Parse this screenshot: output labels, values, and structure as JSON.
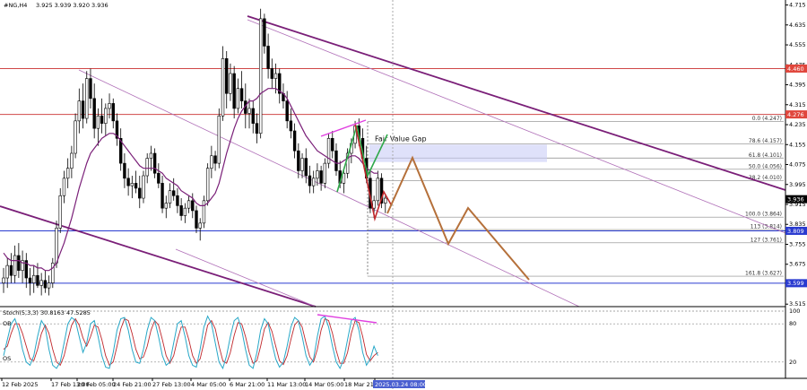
{
  "header": {
    "symbol": "#NG,H4",
    "ohlc": "3.925 3.939 3.920 3.936"
  },
  "chart_data": {
    "type": "candlestick",
    "y_ticks": [
      4.715,
      4.635,
      4.555,
      4.475,
      4.395,
      4.315,
      4.235,
      4.155,
      4.075,
      3.995,
      3.915,
      3.835,
      3.755,
      3.675,
      3.595,
      3.515
    ],
    "price_tags": [
      {
        "value": 4.46,
        "label": "4.460",
        "color": "#e0463c"
      },
      {
        "value": 4.276,
        "label": "4.276",
        "color": "#e0463c"
      },
      {
        "value": 3.936,
        "label": "3.936",
        "color": "#000000"
      },
      {
        "value": 3.809,
        "label": "3.809",
        "color": "#2a3bd0"
      },
      {
        "value": 3.599,
        "label": "3.599",
        "color": "#2a3bd0"
      }
    ],
    "horizontal_levels": [
      {
        "value": 4.46,
        "color": "#d04848"
      },
      {
        "value": 4.276,
        "color": "#d04848"
      },
      {
        "value": 3.809,
        "color": "#2a3bd0"
      },
      {
        "value": 3.599,
        "color": "#2a3bd0"
      }
    ],
    "fibonacci": [
      {
        "label": "0.0 (4.247)",
        "value": 4.247
      },
      {
        "label": "78.6 (4.157)",
        "value": 4.157
      },
      {
        "label": "61.8 (4.101)",
        "value": 4.101
      },
      {
        "label": "50.0 (4.056)",
        "value": 4.056
      },
      {
        "label": "38.2 (4.010)",
        "value": 4.01
      },
      {
        "label": "100.0 (3.864)",
        "value": 3.864
      },
      {
        "label": "113 (3.814)",
        "value": 3.814
      },
      {
        "label": "127 (3.761)",
        "value": 3.761
      },
      {
        "label": "161.8 (3.627)",
        "value": 3.627
      }
    ],
    "fair_value_gap": {
      "label": "Fair Value Gap",
      "top": 4.155,
      "bottom": 4.085
    },
    "x_tick_labels": [
      "12 Feb 2025",
      "17 Feb 13:00",
      "20 Feb 05:00",
      "24 Feb 21:00",
      "27 Feb 13:00",
      "4 Mar 05:00",
      "6 Mar 21:00",
      "11 Mar 13:00",
      "14 Mar 05:00",
      "18 Mar 21:00",
      "2025.03.24 08:00"
    ],
    "candles": [
      [
        3.6,
        3.66,
        3.56,
        3.62
      ],
      [
        3.62,
        3.7,
        3.58,
        3.67
      ],
      [
        3.67,
        3.72,
        3.6,
        3.63
      ],
      [
        3.63,
        3.75,
        3.6,
        3.71
      ],
      [
        3.71,
        3.76,
        3.62,
        3.65
      ],
      [
        3.65,
        3.73,
        3.6,
        3.69
      ],
      [
        3.69,
        3.72,
        3.58,
        3.62
      ],
      [
        3.62,
        3.66,
        3.55,
        3.6
      ],
      [
        3.6,
        3.67,
        3.56,
        3.63
      ],
      [
        3.63,
        3.68,
        3.58,
        3.59
      ],
      [
        3.59,
        3.64,
        3.55,
        3.61
      ],
      [
        3.61,
        3.65,
        3.56,
        3.58
      ],
      [
        3.58,
        3.63,
        3.55,
        3.6
      ],
      [
        3.6,
        3.7,
        3.58,
        3.68
      ],
      [
        3.68,
        3.85,
        3.66,
        3.82
      ],
      [
        3.82,
        3.98,
        3.8,
        3.95
      ],
      [
        3.95,
        4.05,
        3.92,
        4.02
      ],
      [
        4.02,
        4.1,
        3.98,
        4.06
      ],
      [
        4.06,
        4.15,
        4.02,
        4.12
      ],
      [
        4.12,
        4.28,
        4.1,
        4.25
      ],
      [
        4.25,
        4.38,
        4.2,
        4.33
      ],
      [
        4.33,
        4.4,
        4.22,
        4.26
      ],
      [
        4.26,
        4.45,
        4.24,
        4.42
      ],
      [
        4.42,
        4.46,
        4.3,
        4.34
      ],
      [
        4.34,
        4.4,
        4.18,
        4.22
      ],
      [
        4.22,
        4.3,
        4.15,
        4.27
      ],
      [
        4.27,
        4.34,
        4.2,
        4.24
      ],
      [
        4.24,
        4.32,
        4.19,
        4.3
      ],
      [
        4.3,
        4.36,
        4.26,
        4.32
      ],
      [
        4.32,
        4.34,
        4.22,
        4.25
      ],
      [
        4.25,
        4.28,
        4.15,
        4.18
      ],
      [
        4.18,
        4.22,
        4.05,
        4.08
      ],
      [
        4.08,
        4.12,
        3.98,
        4.02
      ],
      [
        4.02,
        4.06,
        3.95,
        3.99
      ],
      [
        3.99,
        4.03,
        3.94,
        4.0
      ],
      [
        4.0,
        4.05,
        3.96,
        3.98
      ],
      [
        3.98,
        4.03,
        3.9,
        3.94
      ],
      [
        3.94,
        4.05,
        3.92,
        4.03
      ],
      [
        4.03,
        4.12,
        4.0,
        4.1
      ],
      [
        4.1,
        4.15,
        4.05,
        4.12
      ],
      [
        4.12,
        4.14,
        4.02,
        4.04
      ],
      [
        4.04,
        4.08,
        3.98,
        4.0
      ],
      [
        4.0,
        4.03,
        3.88,
        3.9
      ],
      [
        3.9,
        3.95,
        3.86,
        3.92
      ],
      [
        3.92,
        4.0,
        3.9,
        3.97
      ],
      [
        3.97,
        4.02,
        3.93,
        3.95
      ],
      [
        3.95,
        3.98,
        3.88,
        3.91
      ],
      [
        3.91,
        3.94,
        3.85,
        3.87
      ],
      [
        3.87,
        3.92,
        3.84,
        3.9
      ],
      [
        3.9,
        3.95,
        3.88,
        3.93
      ],
      [
        3.93,
        3.96,
        3.86,
        3.89
      ],
      [
        3.89,
        3.91,
        3.8,
        3.82
      ],
      [
        3.82,
        3.86,
        3.77,
        3.84
      ],
      [
        3.84,
        3.95,
        3.82,
        3.93
      ],
      [
        3.93,
        4.08,
        3.91,
        4.06
      ],
      [
        4.06,
        4.15,
        4.02,
        4.11
      ],
      [
        4.11,
        4.13,
        4.05,
        4.08
      ],
      [
        4.08,
        4.3,
        4.06,
        4.27
      ],
      [
        4.27,
        4.55,
        4.25,
        4.5
      ],
      [
        4.5,
        4.53,
        4.3,
        4.36
      ],
      [
        4.36,
        4.48,
        4.33,
        4.44
      ],
      [
        4.44,
        4.47,
        4.26,
        4.3
      ],
      [
        4.3,
        4.42,
        4.28,
        4.38
      ],
      [
        4.38,
        4.45,
        4.3,
        4.33
      ],
      [
        4.33,
        4.4,
        4.22,
        4.28
      ],
      [
        4.28,
        4.34,
        4.22,
        4.3
      ],
      [
        4.3,
        4.33,
        4.2,
        4.24
      ],
      [
        4.24,
        4.28,
        4.16,
        4.2
      ],
      [
        4.2,
        4.7,
        4.18,
        4.66
      ],
      [
        4.66,
        4.68,
        4.52,
        4.55
      ],
      [
        4.55,
        4.6,
        4.42,
        4.46
      ],
      [
        4.46,
        4.5,
        4.38,
        4.42
      ],
      [
        4.42,
        4.48,
        4.36,
        4.44
      ],
      [
        4.44,
        4.46,
        4.32,
        4.36
      ],
      [
        4.36,
        4.4,
        4.3,
        4.33
      ],
      [
        4.33,
        4.37,
        4.22,
        4.25
      ],
      [
        4.25,
        4.3,
        4.18,
        4.21
      ],
      [
        4.21,
        4.24,
        4.1,
        4.13
      ],
      [
        4.13,
        4.16,
        4.02,
        4.05
      ],
      [
        4.05,
        4.12,
        4.02,
        4.1
      ],
      [
        4.1,
        4.14,
        4.0,
        4.03
      ],
      [
        4.03,
        4.07,
        3.96,
        3.99
      ],
      [
        3.99,
        4.05,
        3.96,
        4.02
      ],
      [
        4.02,
        4.08,
        3.99,
        4.05
      ],
      [
        4.05,
        4.07,
        3.97,
        4.0
      ],
      [
        4.0,
        4.1,
        3.98,
        4.08
      ],
      [
        4.08,
        4.2,
        4.06,
        4.18
      ],
      [
        4.18,
        4.21,
        4.1,
        4.13
      ],
      [
        4.13,
        4.16,
        4.03,
        4.05
      ],
      [
        4.05,
        4.09,
        3.98,
        4.0
      ],
      [
        4.0,
        4.06,
        3.96,
        4.04
      ],
      [
        4.04,
        4.14,
        4.02,
        4.12
      ],
      [
        4.12,
        4.18,
        4.08,
        4.16
      ],
      [
        4.16,
        4.25,
        4.14,
        4.23
      ],
      [
        4.23,
        4.26,
        4.15,
        4.18
      ],
      [
        4.18,
        4.22,
        4.08,
        4.1
      ],
      [
        4.1,
        4.15,
        4.0,
        4.02
      ],
      [
        4.02,
        4.05,
        3.88,
        3.9
      ],
      [
        3.9,
        3.95,
        3.86,
        3.93
      ],
      [
        3.93,
        4.05,
        3.91,
        4.02
      ],
      [
        4.02,
        4.04,
        3.9,
        3.92
      ],
      [
        3.92,
        3.95,
        3.88,
        3.94
      ]
    ],
    "ma": [
      3.72,
      3.7,
      3.69,
      3.69,
      3.69,
      3.68,
      3.68,
      3.67,
      3.67,
      3.66,
      3.66,
      3.65,
      3.65,
      3.66,
      3.68,
      3.72,
      3.76,
      3.81,
      3.86,
      3.92,
      3.98,
      4.03,
      4.08,
      4.12,
      4.14,
      4.16,
      4.18,
      4.19,
      4.2,
      4.2,
      4.19,
      4.17,
      4.15,
      4.13,
      4.11,
      4.09,
      4.07,
      4.06,
      4.06,
      4.06,
      4.06,
      4.05,
      4.04,
      4.02,
      4.01,
      4.0,
      3.99,
      3.97,
      3.96,
      3.95,
      3.94,
      3.92,
      3.91,
      3.91,
      3.92,
      3.94,
      3.96,
      4.0,
      4.06,
      4.12,
      4.17,
      4.22,
      4.26,
      4.29,
      4.31,
      4.33,
      4.33,
      4.34,
      4.36,
      4.37,
      4.38,
      4.38,
      4.38,
      4.37,
      4.36,
      4.34,
      4.31,
      4.28,
      4.25,
      4.22,
      4.19,
      4.17,
      4.15,
      4.13,
      4.12,
      4.11,
      4.1,
      4.09,
      4.08,
      4.08,
      4.09,
      4.1,
      4.11,
      4.11,
      4.1,
      4.08,
      4.06,
      4.05,
      4.04,
      4.04
    ],
    "projection_path": [
      [
        3.92,
        0
      ],
      [
        4.12,
        1
      ],
      [
        3.77,
        2
      ],
      [
        3.91,
        3
      ],
      [
        3.64,
        4
      ]
    ],
    "stoch": {
      "label": "Stoch(5,3,3) 30.8163 47.5285",
      "levels": [
        100,
        80,
        20
      ],
      "level_labels": [
        "100",
        "80",
        "20"
      ],
      "ob_label": "OB",
      "os_label": "OS",
      "k": [
        30,
        55,
        80,
        88,
        70,
        40,
        20,
        15,
        30,
        60,
        85,
        75,
        40,
        15,
        10,
        20,
        50,
        80,
        90,
        85,
        60,
        35,
        50,
        80,
        85,
        60,
        30,
        12,
        10,
        35,
        70,
        88,
        90,
        70,
        40,
        20,
        18,
        40,
        70,
        90,
        85,
        60,
        30,
        15,
        20,
        50,
        80,
        85,
        60,
        30,
        15,
        12,
        40,
        75,
        92,
        80,
        50,
        20,
        10,
        30,
        60,
        85,
        90,
        70,
        40,
        15,
        10,
        35,
        70,
        88,
        80,
        50,
        25,
        12,
        20,
        45,
        75,
        90,
        85,
        60,
        30,
        15,
        25,
        60,
        88,
        92,
        75,
        45,
        20,
        10,
        25,
        55,
        85,
        90,
        70,
        35,
        15,
        25,
        45,
        30
      ],
      "d": [
        40,
        45,
        65,
        80,
        80,
        65,
        45,
        25,
        22,
        40,
        65,
        78,
        65,
        40,
        20,
        15,
        30,
        55,
        78,
        88,
        78,
        58,
        45,
        60,
        78,
        75,
        55,
        30,
        15,
        20,
        45,
        72,
        88,
        85,
        65,
        40,
        25,
        28,
        45,
        70,
        85,
        78,
        55,
        30,
        18,
        30,
        55,
        75,
        75,
        55,
        30,
        18,
        25,
        50,
        78,
        85,
        72,
        45,
        22,
        18,
        35,
        62,
        82,
        80,
        60,
        35,
        18,
        22,
        45,
        72,
        82,
        68,
        45,
        22,
        16,
        30,
        55,
        78,
        85,
        75,
        50,
        28,
        20,
        40,
        70,
        88,
        85,
        65,
        38,
        18,
        18,
        35,
        65,
        85,
        82,
        60,
        32,
        22,
        30,
        35
      ]
    }
  }
}
